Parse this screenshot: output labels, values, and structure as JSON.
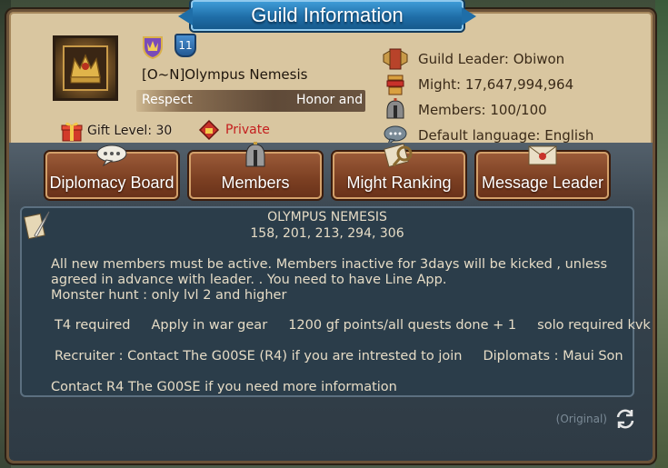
{
  "window": {
    "title": "Guild Information"
  },
  "guild": {
    "rank_badge_icon": "rank-shield-icon",
    "level": "11",
    "name": "[O~N]Olympus Nemesis",
    "motto_left": "Respect",
    "motto_right": "Honor and",
    "gift_level": "Gift Level: 30",
    "privacy": "Private"
  },
  "info": {
    "leader": "Guild Leader: Obiwon",
    "might": "Might: 17,647,994,964",
    "members": "Members: 100/100",
    "language": "Default language: English"
  },
  "buttons": {
    "diplomacy": "Diplomacy Board",
    "members": "Members",
    "might_ranking": "Might Ranking",
    "message_leader": "Message Leader"
  },
  "description": {
    "title": "OLYMPUS NEMESIS",
    "subtitle": "158, 201, 213, 294, 306",
    "line1": "All new members must be active. Members inactive for 3days will be kicked , unless",
    "line2": "agreed in advance with leader.  . You need to have Line App.",
    "line3": "Monster hunt : only lvl 2 and higher",
    "line4": "T4 required     Apply in war gear     1200 gf points/all quests done + 1     solo required kvk",
    "line5": "Recruiter : Contact The G00SE (R4) if you are intrested to join     Diplomats : Maui Son",
    "line6": "Contact R4 The G00SE if you need more information",
    "original_label": "(Original)"
  },
  "colors": {
    "banner": "#1f6ea8",
    "parchment": "#d9c6a0",
    "button": "#7b3f22",
    "panel": "#2b3d4a",
    "private": "#c41e1e"
  }
}
